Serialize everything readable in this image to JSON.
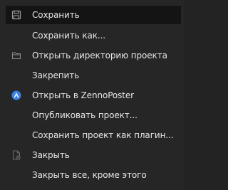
{
  "menu": {
    "items": [
      {
        "label": "Сохранить",
        "icon": "save-icon"
      },
      {
        "label": "Сохранить как..."
      },
      {
        "label": "Открыть директорию проекта",
        "icon": "folder-icon"
      },
      {
        "label": "Закрепить"
      },
      {
        "label": "Открыть в ZennoPoster",
        "icon": "zennoposter-icon"
      },
      {
        "label": "Опубликовать проект..."
      },
      {
        "label": "Сохранить проект как плагин..."
      },
      {
        "label": "Закрыть",
        "icon": "close-document-icon"
      },
      {
        "label": "Закрыть все, кроме этого"
      }
    ]
  },
  "colors": {
    "background": "#262626",
    "hover": "#141414",
    "text": "#e6e6e6",
    "accent": "#3b82e6"
  }
}
